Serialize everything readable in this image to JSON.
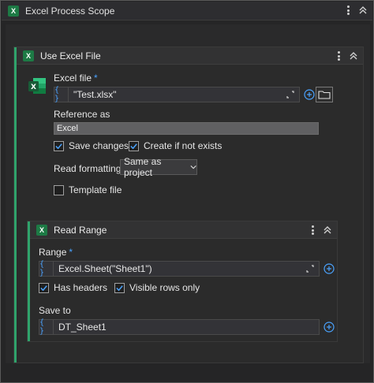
{
  "scope": {
    "title": "Excel Process Scope",
    "icon": "excel-icon"
  },
  "use_excel_file": {
    "title": "Use Excel File",
    "excel_file_label": "Excel file",
    "required_mark": "*",
    "excel_file_value": "\"Test.xlsx\"",
    "brace": "{ }",
    "reference_as_label": "Reference as",
    "reference_as_value": "Excel",
    "save_changes_label": "Save changes",
    "save_changes_checked": true,
    "create_if_not_exists_label": "Create if not exists",
    "create_if_not_exists_checked": true,
    "read_formatting_label": "Read formatting",
    "read_formatting_value": "Same as project",
    "template_file_label": "Template file",
    "template_file_checked": false
  },
  "read_range": {
    "title": "Read Range",
    "range_label": "Range",
    "required_mark": "*",
    "range_value": "Excel.Sheet(\"Sheet1\")",
    "brace": "{ }",
    "has_headers_label": "Has headers",
    "has_headers_checked": true,
    "visible_rows_only_label": "Visible rows only",
    "visible_rows_only_checked": true,
    "save_to_label": "Save to",
    "save_to_value": "DT_Sheet1"
  },
  "colors": {
    "accent": "#2fa36b",
    "brace": "#4aa3ff",
    "excel_green": "#1d7a45"
  }
}
